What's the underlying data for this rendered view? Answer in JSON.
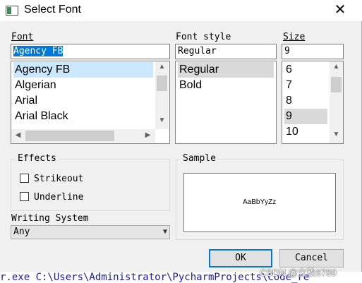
{
  "window": {
    "title": "Select Font",
    "close_glyph": "✕",
    "icon": "app-window-icon"
  },
  "font": {
    "label": "Font",
    "input_value": "Agency FB",
    "items": [
      "Agency FB",
      "Algerian",
      "Arial",
      "Arial Black"
    ],
    "selected": "Agency FB"
  },
  "font_style": {
    "label": "Font style",
    "input_value": "Regular",
    "items": [
      "Regular",
      "Bold"
    ],
    "selected": "Regular"
  },
  "size": {
    "label": "Size",
    "input_value": "9",
    "items": [
      "6",
      "7",
      "8",
      "9",
      "10"
    ],
    "selected": "9"
  },
  "effects": {
    "label": "Effects",
    "strikeout_label": "Strikeout",
    "underline_label": "Underline",
    "strikeout_checked": false,
    "underline_checked": false
  },
  "writing_system": {
    "label": "Writing System",
    "value": "Any"
  },
  "sample": {
    "label": "Sample",
    "text": "AaBbYyZz"
  },
  "buttons": {
    "ok": "OK",
    "cancel": "Cancel"
  },
  "background": {
    "console_text": "r.exe C:\\Users\\Administrator\\PycharmProjects\\Code_re",
    "watermark": "CSDN @立秋6789"
  },
  "colors": {
    "accent": "#0078d7",
    "selection": "#cce8ff",
    "dialog_bg": "#f0f0f0"
  }
}
